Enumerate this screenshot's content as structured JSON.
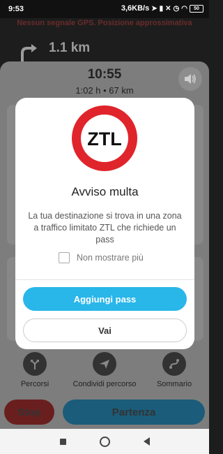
{
  "status_bar": {
    "time": "9:53",
    "network_speed": "3,6KB/s",
    "battery": "50",
    "icons": [
      "location-icon",
      "signal-icon",
      "mute-icon",
      "alarm-icon",
      "wifi-icon",
      "battery-icon"
    ]
  },
  "navigation": {
    "gps_banner": "Nessun segnale GPS. Posizione approssimativa",
    "distance": "1.1 km",
    "eta_time": "10:55",
    "duration": "1:02 h",
    "separator": "•",
    "trip_distance": "67 km"
  },
  "bottom_actions": [
    {
      "label": "Percorsi",
      "icon": "routes-icon"
    },
    {
      "label": "Condividi percorso",
      "icon": "share-route-icon"
    },
    {
      "label": "Sommario",
      "icon": "summary-icon"
    }
  ],
  "buttons": {
    "stop": "Stop",
    "start": "Partenza"
  },
  "modal": {
    "sign_text": "ZTL",
    "title": "Avviso multa",
    "body": "La tua destinazione si trova in una zona a traffico limitato ZTL che richiede un pass",
    "checkbox_label": "Non mostrare più",
    "checkbox_checked": false,
    "primary_button": "Aggiungi pass",
    "secondary_button": "Vai"
  },
  "colors": {
    "accent": "#29b6e9",
    "sign_red": "#e0242b",
    "stop": "#6a1f1f",
    "start": "#1a5c7a"
  }
}
